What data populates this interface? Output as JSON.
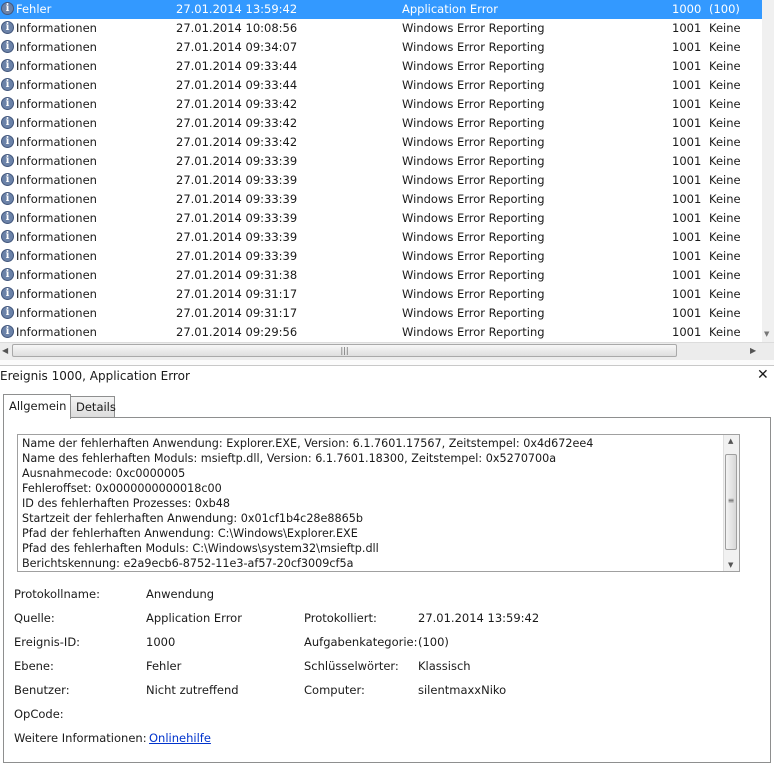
{
  "events": [
    {
      "level": "Fehler",
      "date": "27.01.2014 13:59:42",
      "source": "Application Error",
      "id": "1000",
      "category": "(100)",
      "selected": true
    },
    {
      "level": "Informationen",
      "date": "27.01.2014 10:08:56",
      "source": "Windows Error Reporting",
      "id": "1001",
      "category": "Keine"
    },
    {
      "level": "Informationen",
      "date": "27.01.2014 09:34:07",
      "source": "Windows Error Reporting",
      "id": "1001",
      "category": "Keine"
    },
    {
      "level": "Informationen",
      "date": "27.01.2014 09:33:44",
      "source": "Windows Error Reporting",
      "id": "1001",
      "category": "Keine"
    },
    {
      "level": "Informationen",
      "date": "27.01.2014 09:33:44",
      "source": "Windows Error Reporting",
      "id": "1001",
      "category": "Keine"
    },
    {
      "level": "Informationen",
      "date": "27.01.2014 09:33:42",
      "source": "Windows Error Reporting",
      "id": "1001",
      "category": "Keine"
    },
    {
      "level": "Informationen",
      "date": "27.01.2014 09:33:42",
      "source": "Windows Error Reporting",
      "id": "1001",
      "category": "Keine"
    },
    {
      "level": "Informationen",
      "date": "27.01.2014 09:33:42",
      "source": "Windows Error Reporting",
      "id": "1001",
      "category": "Keine"
    },
    {
      "level": "Informationen",
      "date": "27.01.2014 09:33:39",
      "source": "Windows Error Reporting",
      "id": "1001",
      "category": "Keine"
    },
    {
      "level": "Informationen",
      "date": "27.01.2014 09:33:39",
      "source": "Windows Error Reporting",
      "id": "1001",
      "category": "Keine"
    },
    {
      "level": "Informationen",
      "date": "27.01.2014 09:33:39",
      "source": "Windows Error Reporting",
      "id": "1001",
      "category": "Keine"
    },
    {
      "level": "Informationen",
      "date": "27.01.2014 09:33:39",
      "source": "Windows Error Reporting",
      "id": "1001",
      "category": "Keine"
    },
    {
      "level": "Informationen",
      "date": "27.01.2014 09:33:39",
      "source": "Windows Error Reporting",
      "id": "1001",
      "category": "Keine"
    },
    {
      "level": "Informationen",
      "date": "27.01.2014 09:33:39",
      "source": "Windows Error Reporting",
      "id": "1001",
      "category": "Keine"
    },
    {
      "level": "Informationen",
      "date": "27.01.2014 09:31:38",
      "source": "Windows Error Reporting",
      "id": "1001",
      "category": "Keine"
    },
    {
      "level": "Informationen",
      "date": "27.01.2014 09:31:17",
      "source": "Windows Error Reporting",
      "id": "1001",
      "category": "Keine"
    },
    {
      "level": "Informationen",
      "date": "27.01.2014 09:31:17",
      "source": "Windows Error Reporting",
      "id": "1001",
      "category": "Keine"
    },
    {
      "level": "Informationen",
      "date": "27.01.2014 09:29:56",
      "source": "Windows Error Reporting",
      "id": "1001",
      "category": "Keine"
    }
  ],
  "icons": {
    "row_icon": "info-icon",
    "selected_color": "#3399ff",
    "link_color": "#0033cc"
  },
  "detail": {
    "title": "Ereignis 1000, Application Error",
    "close": "✕",
    "tabs": [
      {
        "label": "Allgemein"
      },
      {
        "label": "Details"
      }
    ],
    "description": [
      "Name der fehlerhaften Anwendung: Explorer.EXE, Version: 6.1.7601.17567, Zeitstempel: 0x4d672ee4",
      "Name des fehlerhaften Moduls: msieftp.dll, Version: 6.1.7601.18300, Zeitstempel: 0x5270700a",
      "Ausnahmecode: 0xc0000005",
      "Fehleroffset: 0x0000000000018c00",
      "ID des fehlerhaften Prozesses: 0xb48",
      "Startzeit der fehlerhaften Anwendung: 0x01cf1b4c28e8865b",
      "Pfad der fehlerhaften Anwendung: C:\\Windows\\Explorer.EXE",
      "Pfad des fehlerhaften Moduls: C:\\Windows\\system32\\msieftp.dll",
      "Berichtskennung: e2a9ecb6-8752-11e3-af57-20cf3009cf5a"
    ],
    "props": {
      "protokollname_label": "Protokollname:",
      "protokollname": "Anwendung",
      "quelle_label": "Quelle:",
      "quelle": "Application Error",
      "protokolliert_label": "Protokolliert:",
      "protokolliert": "27.01.2014 13:59:42",
      "ereignis_id_label": "Ereignis-ID:",
      "ereignis_id": "1000",
      "aufgabenkategorie_label": "Aufgabenkategorie:",
      "aufgabenkategorie": "(100)",
      "ebene_label": "Ebene:",
      "ebene": "Fehler",
      "schluesselwoerter_label": "Schlüsselwörter:",
      "schluesselwoerter": "Klassisch",
      "benutzer_label": "Benutzer:",
      "benutzer": "Nicht zutreffend",
      "computer_label": "Computer:",
      "computer": "silentmaxxNiko",
      "opcode_label": "OpCode:",
      "weitere_label": "Weitere Informationen:",
      "weitere_link": "Onlinehilfe"
    }
  }
}
